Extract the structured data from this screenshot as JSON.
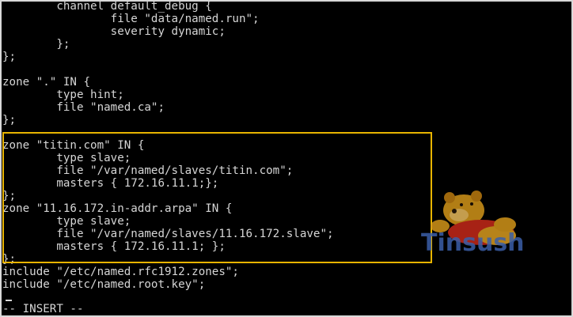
{
  "editor": {
    "lines": [
      "        channel default_debug {",
      "                file \"data/named.run\";",
      "                severity dynamic;",
      "        };",
      "};",
      "",
      "zone \".\" IN {",
      "        type hint;",
      "        file \"named.ca\";",
      "};",
      "",
      "zone \"titin.com\" IN {",
      "        type slave;",
      "        file \"/var/named/slaves/titin.com\";",
      "        masters { 172.16.11.1;};",
      "};",
      "zone \"11.16.172.in-addr.arpa\" IN {",
      "        type slave;",
      "        file \"/var/named/slaves/11.16.172.slave\";",
      "        masters { 172.16.11.1; };",
      "};",
      "include \"/etc/named.rfc1912.zones\";",
      "include \"/etc/named.root.key\";",
      ""
    ],
    "mode_line": "-- INSERT --"
  },
  "watermark": {
    "text": "Tinsush",
    "icon": "winnie-the-pooh-icon"
  },
  "colors": {
    "background": "#000000",
    "text": "#d6d6d6",
    "highlight": "#e8b400",
    "watermark": "#3b5fa8"
  }
}
